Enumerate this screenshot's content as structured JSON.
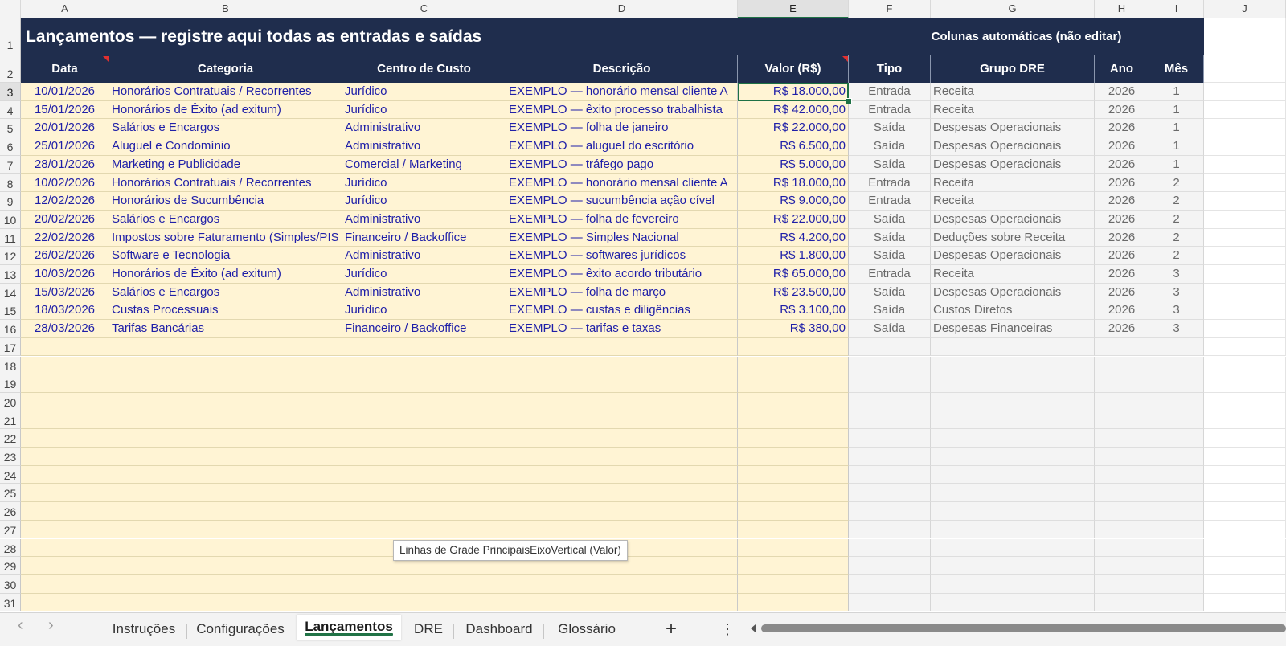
{
  "columns": [
    "A",
    "B",
    "C",
    "D",
    "E",
    "F",
    "G",
    "H",
    "I",
    "J"
  ],
  "title": "Lançamentos — registre aqui todas as entradas e saídas",
  "auto_title": "Colunas automáticas (não editar)",
  "headers": [
    "Data",
    "Categoria",
    "Centro de Custo",
    "Descrição",
    "Valor (R$)",
    "Tipo",
    "Grupo DRE",
    "Ano",
    "Mês"
  ],
  "rows": [
    [
      "10/01/2026",
      "Honorários Contratuais / Recorrentes",
      "Jurídico",
      "EXEMPLO — honorário mensal cliente A",
      "R$ 18.000,00",
      "Entrada",
      "Receita",
      "2026",
      "1"
    ],
    [
      "15/01/2026",
      "Honorários de Êxito (ad exitum)",
      "Jurídico",
      "EXEMPLO — êxito processo trabalhista",
      "R$ 42.000,00",
      "Entrada",
      "Receita",
      "2026",
      "1"
    ],
    [
      "20/01/2026",
      "Salários e Encargos",
      "Administrativo",
      "EXEMPLO — folha de janeiro",
      "R$ 22.000,00",
      "Saída",
      "Despesas Operacionais",
      "2026",
      "1"
    ],
    [
      "25/01/2026",
      "Aluguel e Condomínio",
      "Administrativo",
      "EXEMPLO — aluguel do escritório",
      "R$ 6.500,00",
      "Saída",
      "Despesas Operacionais",
      "2026",
      "1"
    ],
    [
      "28/01/2026",
      "Marketing e Publicidade",
      "Comercial / Marketing",
      "EXEMPLO — tráfego pago",
      "R$ 5.000,00",
      "Saída",
      "Despesas Operacionais",
      "2026",
      "1"
    ],
    [
      "10/02/2026",
      "Honorários Contratuais / Recorrentes",
      "Jurídico",
      "EXEMPLO — honorário mensal cliente A",
      "R$ 18.000,00",
      "Entrada",
      "Receita",
      "2026",
      "2"
    ],
    [
      "12/02/2026",
      "Honorários de Sucumbência",
      "Jurídico",
      "EXEMPLO — sucumbência ação cível",
      "R$ 9.000,00",
      "Entrada",
      "Receita",
      "2026",
      "2"
    ],
    [
      "20/02/2026",
      "Salários e Encargos",
      "Administrativo",
      "EXEMPLO — folha de fevereiro",
      "R$ 22.000,00",
      "Saída",
      "Despesas Operacionais",
      "2026",
      "2"
    ],
    [
      "22/02/2026",
      "Impostos sobre Faturamento (Simples/PIS",
      "Financeiro / Backoffice",
      "EXEMPLO — Simples Nacional",
      "R$ 4.200,00",
      "Saída",
      "Deduções sobre Receita",
      "2026",
      "2"
    ],
    [
      "26/02/2026",
      "Software e Tecnologia",
      "Administrativo",
      "EXEMPLO — softwares jurídicos",
      "R$ 1.800,00",
      "Saída",
      "Despesas Operacionais",
      "2026",
      "2"
    ],
    [
      "10/03/2026",
      "Honorários de Êxito (ad exitum)",
      "Jurídico",
      "EXEMPLO — êxito acordo tributário",
      "R$ 65.000,00",
      "Entrada",
      "Receita",
      "2026",
      "3"
    ],
    [
      "15/03/2026",
      "Salários e Encargos",
      "Administrativo",
      "EXEMPLO — folha de março",
      "R$ 23.500,00",
      "Saída",
      "Despesas Operacionais",
      "2026",
      "3"
    ],
    [
      "18/03/2026",
      "Custas Processuais",
      "Jurídico",
      "EXEMPLO — custas e diligências",
      "R$ 3.100,00",
      "Saída",
      "Custos Diretos",
      "2026",
      "3"
    ],
    [
      "28/03/2026",
      "Tarifas Bancárias",
      "Financeiro / Backoffice",
      "EXEMPLO — tarifas e taxas",
      "R$ 380,00",
      "Saída",
      "Despesas Financeiras",
      "2026",
      "3"
    ]
  ],
  "row_numbers": [
    "1",
    "2",
    "3",
    "4",
    "5",
    "6",
    "7",
    "8",
    "9",
    "10",
    "11",
    "12",
    "13",
    "14",
    "15",
    "16",
    "17",
    "18",
    "19",
    "20",
    "21",
    "22",
    "23",
    "24",
    "25",
    "26",
    "27",
    "28",
    "29",
    "30",
    "31"
  ],
  "tooltip": "Linhas de Grade PrincipaisEixoVertical (Valor)",
  "sheet_tabs": [
    "Instruções",
    "Configurações",
    "Lançamentos",
    "DRE",
    "Dashboard",
    "Glossário"
  ],
  "active_tab": "Lançamentos",
  "add_sheet": "+",
  "more_menu": "⋮",
  "nav_prev": "‹",
  "nav_next": "›",
  "colors": {
    "header_navy": "#1f2d4d",
    "input_fill": "#fff4d4",
    "input_text": "#1f1fa8",
    "auto_fill": "#f4f4f4",
    "excel_green": "#217346"
  }
}
